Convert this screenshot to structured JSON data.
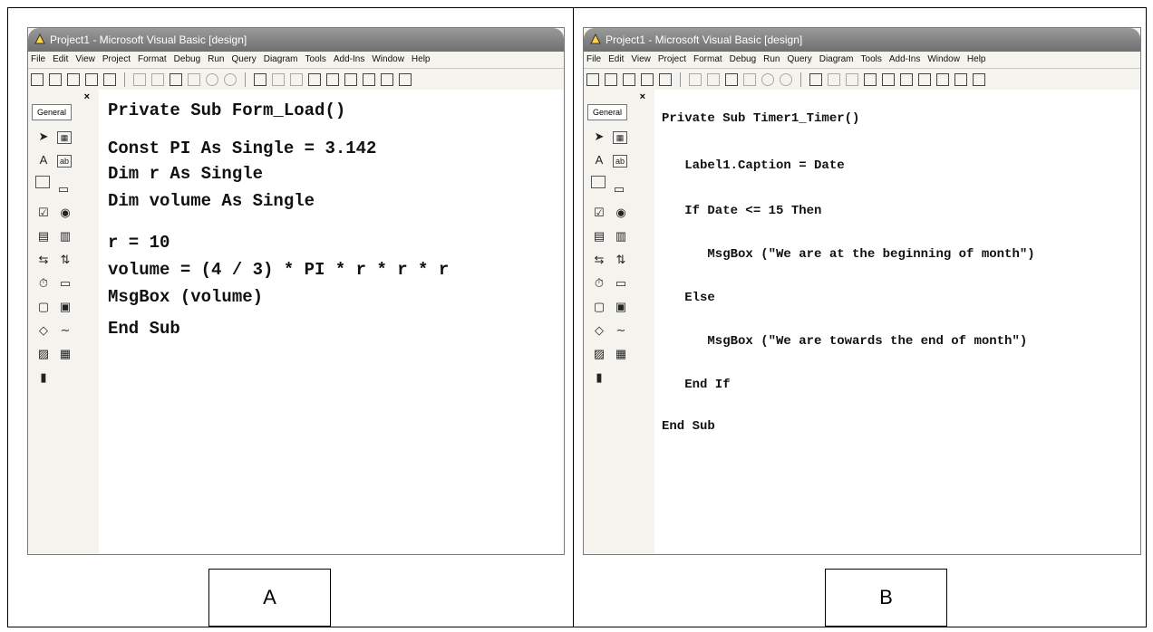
{
  "window_title": "Project1 - Microsoft Visual Basic [design]",
  "menu": [
    "File",
    "Edit",
    "View",
    "Project",
    "Format",
    "Debug",
    "Run",
    "Query",
    "Diagram",
    "Tools",
    "Add-Ins",
    "Window",
    "Help"
  ],
  "toolbox": {
    "close": "×",
    "general_tab": "General"
  },
  "code_a": [
    "Private Sub Form_Load()",
    "Const PI As Single = 3.142",
    "Dim r As Single",
    "Dim volume As Single",
    "r = 10",
    "volume = (4 / 3) * PI * r * r * r",
    "MsgBox (volume)",
    "End Sub"
  ],
  "code_b": [
    "Private Sub Timer1_Timer()",
    "   Label1.Caption = Date",
    "   If Date <= 15 Then",
    "      MsgBox (\"We are at the beginning of month\")",
    "   Else",
    "      MsgBox (\"We are towards the end of month\")",
    "   End If",
    "End Sub"
  ],
  "labels": {
    "a": "A",
    "b": "B"
  },
  "colors": {
    "titlebar": "#7f7f7f",
    "ide_bg": "#f4f3ee",
    "code_bg": "#ffffff"
  }
}
